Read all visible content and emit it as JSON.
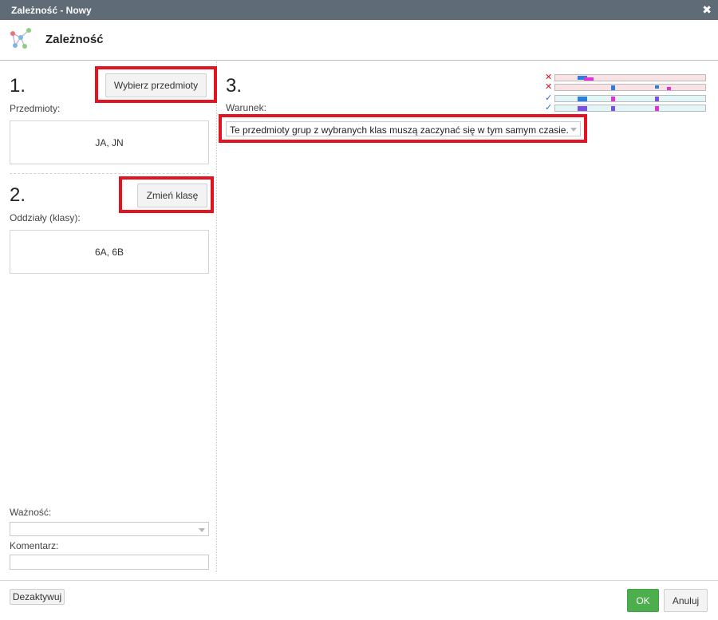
{
  "window": {
    "title": "Zależność - Nowy",
    "close_icon": "✖"
  },
  "header": {
    "title": "Zależność",
    "logo_icon": "dependency-graph-icon"
  },
  "step1": {
    "number": "1.",
    "button": "Wybierz przedmioty",
    "label": "Przedmioty:",
    "value": "JA, JN"
  },
  "step2": {
    "number": "2.",
    "button": "Zmień klasę",
    "label": "Oddziały (klasy):",
    "value": "6A, 6B"
  },
  "step3": {
    "number": "3.",
    "label": "Warunek:",
    "condition": "Te przedmioty grup z wybranych klas muszą zaczynać się w tym samym czasie."
  },
  "preview": {
    "rows": [
      {
        "status": "invalid",
        "mark": "✕",
        "color": "#e2141f"
      },
      {
        "status": "invalid",
        "mark": "✕",
        "color": "#e2141f"
      },
      {
        "status": "valid",
        "mark": "✓",
        "color": "#1a73c9"
      },
      {
        "status": "valid",
        "mark": "✓",
        "color": "#1a73c9"
      }
    ],
    "cell_icon": "1A"
  },
  "importance": {
    "label": "Ważność:",
    "value": ""
  },
  "comment": {
    "label": "Komentarz:",
    "value": ""
  },
  "footer": {
    "deactivate": "Dezaktywuj",
    "ok": "OK",
    "cancel": "Anuluj"
  },
  "colors": {
    "highlight": "#e2141f",
    "ok_button": "#4cae4c",
    "titlebar": "#5f6b76"
  }
}
